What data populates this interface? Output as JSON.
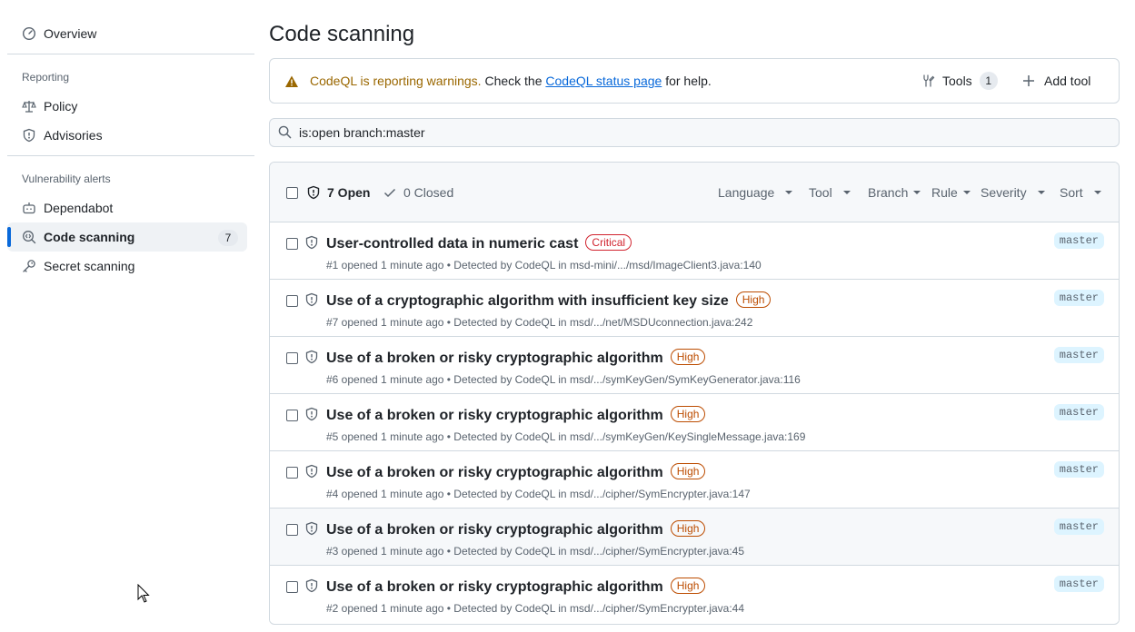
{
  "sidebar": {
    "overview": "Overview",
    "reporting_heading": "Reporting",
    "policy": "Policy",
    "advisories": "Advisories",
    "vuln_heading": "Vulnerability alerts",
    "dependabot": "Dependabot",
    "code_scanning": "Code scanning",
    "code_scanning_count": "7",
    "secret_scanning": "Secret scanning"
  },
  "page": {
    "title": "Code scanning"
  },
  "banner": {
    "warning_text": "CodeQL is reporting warnings.",
    "check_text": " Check the ",
    "link_text": "CodeQL status page",
    "tail_text": " for help.",
    "tools_label": "Tools",
    "tools_count": "1",
    "add_tool_label": "Add tool"
  },
  "search": {
    "value": "is:open branch:master"
  },
  "list_header": {
    "open_label": "7 Open",
    "closed_label": "0 Closed",
    "filters": [
      "Language",
      "Tool",
      "Branch",
      "Rule",
      "Severity",
      "Sort"
    ]
  },
  "alerts": [
    {
      "title": "User-controlled data in numeric cast",
      "severity": "Critical",
      "meta_prefix": "#1 opened 1 minute ago • Detected by CodeQL in ",
      "path": "msd-mini/.../msd/ImageClient3.java",
      "line": ":140",
      "branch": "master"
    },
    {
      "title": "Use of a cryptographic algorithm with insufficient key size",
      "severity": "High",
      "meta_prefix": "#7 opened 1 minute ago • Detected by CodeQL in ",
      "path": "msd/.../net/MSDUconnection.java",
      "line": ":242",
      "branch": "master"
    },
    {
      "title": "Use of a broken or risky cryptographic algorithm",
      "severity": "High",
      "meta_prefix": "#6 opened 1 minute ago • Detected by CodeQL in ",
      "path": "msd/.../symKeyGen/SymKeyGenerator.java",
      "line": ":116",
      "branch": "master"
    },
    {
      "title": "Use of a broken or risky cryptographic algorithm",
      "severity": "High",
      "meta_prefix": "#5 opened 1 minute ago • Detected by CodeQL in ",
      "path": "msd/.../symKeyGen/KeySingleMessage.java",
      "line": ":169",
      "branch": "master"
    },
    {
      "title": "Use of a broken or risky cryptographic algorithm",
      "severity": "High",
      "meta_prefix": "#4 opened 1 minute ago • Detected by CodeQL in ",
      "path": "msd/.../cipher/SymEncrypter.java",
      "line": ":147",
      "branch": "master"
    },
    {
      "title": "Use of a broken or risky cryptographic algorithm",
      "severity": "High",
      "meta_prefix": "#3 opened 1 minute ago • Detected by CodeQL in ",
      "path": "msd/.../cipher/SymEncrypter.java",
      "line": ":45",
      "branch": "master"
    },
    {
      "title": "Use of a broken or risky cryptographic algorithm",
      "severity": "High",
      "meta_prefix": "#2 opened 1 minute ago • Detected by CodeQL in ",
      "path": "msd/.../cipher/SymEncrypter.java",
      "line": ":44",
      "branch": "master"
    }
  ],
  "colors": {
    "accent": "#0969da",
    "critical": "#d1242f",
    "high": "#bc4c00",
    "warning": "#9a6700"
  }
}
